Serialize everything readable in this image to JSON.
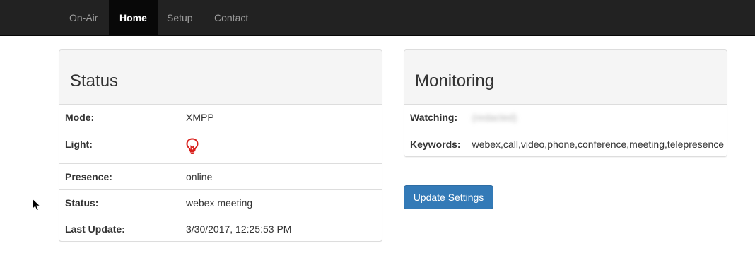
{
  "nav": {
    "items": [
      {
        "label": "On-Air"
      },
      {
        "label": "Home"
      },
      {
        "label": "Setup"
      },
      {
        "label": "Contact"
      }
    ],
    "active": "Home"
  },
  "status_panel": {
    "title": "Status",
    "rows": {
      "mode": {
        "label": "Mode:",
        "value": "XMPP"
      },
      "light": {
        "label": "Light:",
        "icon": "lightbulb-icon",
        "icon_color": "#d9201c"
      },
      "presence": {
        "label": "Presence:",
        "value": "online"
      },
      "status": {
        "label": "Status:",
        "value": "webex meeting"
      },
      "last_update": {
        "label": "Last Update:",
        "value": "3/30/2017, 12:25:53 PM"
      }
    }
  },
  "monitoring_panel": {
    "title": "Monitoring",
    "rows": {
      "watching": {
        "label": "Watching:",
        "value": "(redacted)"
      },
      "keywords": {
        "label": "Keywords:",
        "value": "webex,call,video,phone,conference,meeting,telepresence"
      }
    }
  },
  "actions": {
    "update_label": "Update Settings"
  },
  "colors": {
    "navbar_bg": "#222222",
    "nav_active_bg": "#080808",
    "primary_button": "#337ab7",
    "light_icon": "#d9201c"
  }
}
